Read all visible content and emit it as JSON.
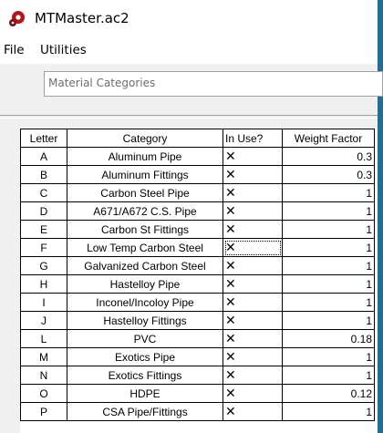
{
  "window": {
    "title": "MTMaster.ac2"
  },
  "menu": {
    "items": [
      "File",
      "Utilities"
    ]
  },
  "group": {
    "label": "Material Categories"
  },
  "table": {
    "columns": [
      "Letter",
      "Category",
      "In Use?",
      "Weight Factor"
    ],
    "rows": [
      {
        "letter": "A",
        "category": "Aluminum Pipe",
        "in_use": "✕",
        "weight": "0.3"
      },
      {
        "letter": "B",
        "category": "Aluminum Fittings",
        "in_use": "✕",
        "weight": "0.3"
      },
      {
        "letter": "C",
        "category": "Carbon Steel Pipe",
        "in_use": "✕",
        "weight": "1"
      },
      {
        "letter": "D",
        "category": "A671/A672 C.S. Pipe",
        "in_use": "✕",
        "weight": "1"
      },
      {
        "letter": "E",
        "category": "Carbon St Fittings",
        "in_use": "✕",
        "weight": "1"
      },
      {
        "letter": "F",
        "category": "Low Temp Carbon Steel",
        "in_use": "✕",
        "weight": "1"
      },
      {
        "letter": "G",
        "category": "Galvanized Carbon Steel",
        "in_use": "✕",
        "weight": "1"
      },
      {
        "letter": "H",
        "category": "Hastelloy Pipe",
        "in_use": "✕",
        "weight": "1"
      },
      {
        "letter": "I",
        "category": "Inconel/Incoloy Pipe",
        "in_use": "✕",
        "weight": "1"
      },
      {
        "letter": "J",
        "category": "Hastelloy Fittings",
        "in_use": "✕",
        "weight": "1"
      },
      {
        "letter": "L",
        "category": "PVC",
        "in_use": "✕",
        "weight": "0.18"
      },
      {
        "letter": "M",
        "category": "Exotics Pipe",
        "in_use": "✕",
        "weight": "1"
      },
      {
        "letter": "N",
        "category": "Exotics Fittings",
        "in_use": "✕",
        "weight": "1"
      },
      {
        "letter": "O",
        "category": "HDPE",
        "in_use": "✕",
        "weight": "0.12"
      },
      {
        "letter": "P",
        "category": "CSA Pipe/Fittings",
        "in_use": "✕",
        "weight": "1"
      }
    ]
  },
  "icons": {
    "app": "red-gear-app-icon"
  },
  "colors": {
    "window_edge": "#1f6f99",
    "app_icon": "#b3161a"
  }
}
